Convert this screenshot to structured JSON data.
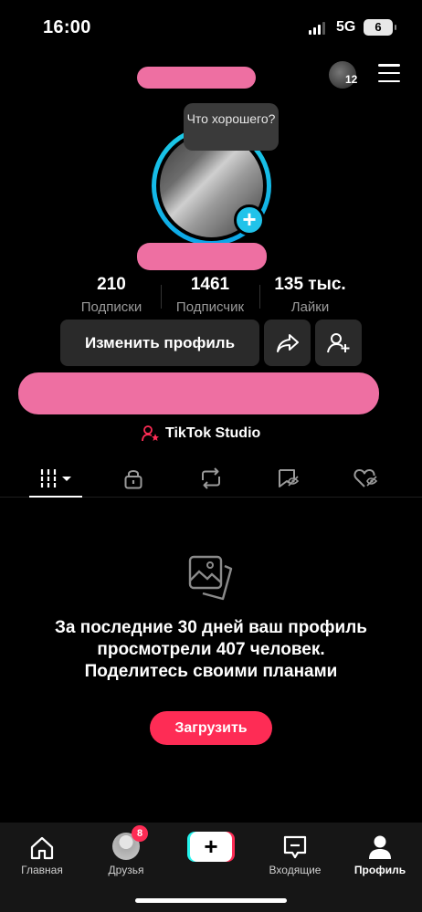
{
  "status_bar": {
    "time": "16:00",
    "network": "5G",
    "battery": "6"
  },
  "header": {
    "avatar_badge": "12"
  },
  "profile": {
    "bubble_text": "Что хорошего?",
    "stats": [
      {
        "value": "210",
        "label": "Подписки"
      },
      {
        "value": "1461",
        "label": "Подписчик"
      },
      {
        "value": "135 тыс.",
        "label": "Лайки"
      }
    ],
    "edit_label": "Изменить профиль",
    "studio_label": "TikTok Studio"
  },
  "tabs": [
    {
      "icon": "grid-icon"
    },
    {
      "icon": "lock-icon"
    },
    {
      "icon": "repost-icon"
    },
    {
      "icon": "saved-icon"
    },
    {
      "icon": "liked-icon"
    }
  ],
  "empty_state": {
    "text": "За последние 30 дней ваш профиль просмотрели 407 человек. Поделитесь своими планами",
    "upload_label": "Загрузить"
  },
  "bottom_nav": {
    "home": "Главная",
    "friends": "Друзья",
    "friends_badge": "8",
    "inbox": "Входящие",
    "profile": "Профиль"
  },
  "colors": {
    "accent": "#fe2c55",
    "ring": "#1fd0e6",
    "redaction": "#ee6fa2"
  }
}
